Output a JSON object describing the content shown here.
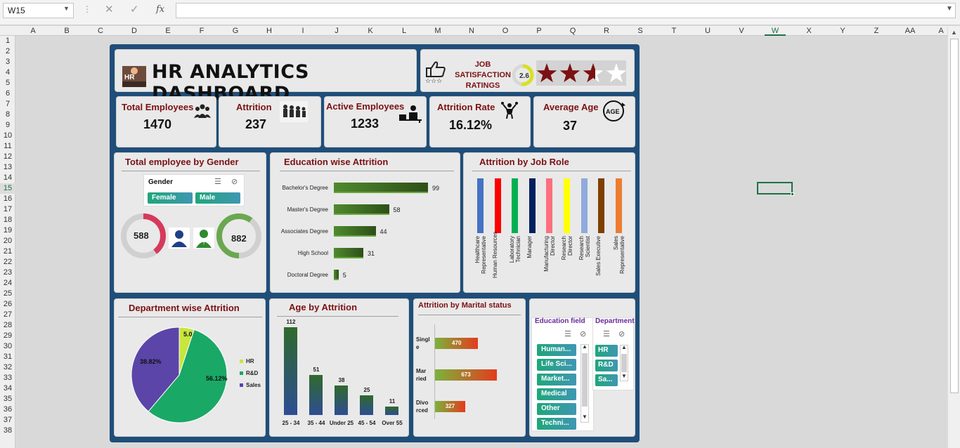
{
  "formula_bar": {
    "name_box": "W15",
    "cancel_icon": "✕",
    "enter_icon": "✓",
    "fx_label": "fx",
    "formula": ""
  },
  "columns": [
    "A",
    "B",
    "C",
    "D",
    "E",
    "F",
    "G",
    "H",
    "I",
    "J",
    "K",
    "L",
    "M",
    "N",
    "O",
    "P",
    "Q",
    "R",
    "S",
    "T",
    "U",
    "V",
    "W",
    "X",
    "Y",
    "Z",
    "AA",
    "A"
  ],
  "selected_column": "W",
  "rows": [
    "1",
    "2",
    "3",
    "4",
    "5",
    "6",
    "7",
    "8",
    "9",
    "10",
    "11",
    "12",
    "13",
    "14",
    "15",
    "16",
    "17",
    "18",
    "19",
    "20",
    "21",
    "22",
    "23",
    "24",
    "25",
    "26",
    "27",
    "28",
    "29",
    "30",
    "31",
    "32",
    "33",
    "34",
    "35",
    "36",
    "37",
    "38"
  ],
  "selected_row": "15",
  "dashboard": {
    "title": "HR ANALYTICS DASHBOARD",
    "logo_text": "HR",
    "job_satisfaction": {
      "label": "JOB SATISFACTION RATINGS",
      "value": "2.6",
      "rating": 2.6,
      "max_stars": 4,
      "star_color": "#7b1113"
    },
    "kpis": [
      {
        "title": "Total Employees",
        "value": "1470",
        "icon": "people-group-icon"
      },
      {
        "title": "Attrition",
        "value": "237",
        "icon": "people-leaving-icon"
      },
      {
        "title": "Active Employees",
        "value": "1233",
        "icon": "employee-desk-icon"
      },
      {
        "title": "Attrition Rate",
        "value": "16.12%",
        "icon": "juggling-person-icon"
      },
      {
        "title": "Average Age",
        "value": "37",
        "icon": "age-icon"
      }
    ],
    "gender": {
      "title": "Total employee by Gender",
      "slicer": {
        "header": "Gender",
        "options": [
          "Female",
          "Male"
        ]
      },
      "female_count": "588",
      "male_count": "882"
    },
    "education_attrition": {
      "title": "Education wise Attrition",
      "chart_data": {
        "type": "bar",
        "orientation": "horizontal",
        "categories": [
          "Bachelor's Degree",
          "Master's Degree",
          "Associates Degree",
          "High School",
          "Doctoral Degree"
        ],
        "values": [
          99,
          58,
          44,
          31,
          5
        ]
      }
    },
    "job_role": {
      "title": "Attrition by Job Role",
      "chart_data": {
        "type": "bar",
        "categories": [
          "Healthcare Representative",
          "Human Resources",
          "Laboratory Technician",
          "Manager",
          "Manufacturing Director",
          "Research Director",
          "Research Scientist",
          "Sales Executive",
          "Sales Representative"
        ],
        "colors": [
          "#4472c4",
          "#ff0000",
          "#00b050",
          "#002060",
          "#ff6f7d",
          "#ffff00",
          "#8faadc",
          "#7f3f00",
          "#ed7d31"
        ]
      }
    },
    "department": {
      "title": "Department wise Attrition",
      "chart_data": {
        "type": "pie",
        "categories": [
          "HR",
          "R&D",
          "Sales"
        ],
        "values": [
          5.06,
          56.12,
          38.82
        ],
        "labels": [
          "5.06%",
          "56.12%",
          "38.82%"
        ],
        "colors": [
          "#c8e63c",
          "#1aa866",
          "#5b45a8"
        ],
        "legend": "right"
      }
    },
    "age": {
      "title": "Age by Attrition",
      "chart_data": {
        "type": "bar",
        "categories": [
          "25 - 34",
          "35 - 44",
          "Under 25",
          "45 - 54",
          "Over 55"
        ],
        "values": [
          112,
          51,
          38,
          25,
          11
        ]
      }
    },
    "marital": {
      "title": "Attrition by Marital status",
      "chart_data": {
        "type": "bar",
        "orientation": "horizontal",
        "categories": [
          "Single",
          "Married",
          "Divorced"
        ],
        "values": [
          470,
          673,
          327
        ]
      }
    },
    "slicers": {
      "education_field": {
        "header": "Education field",
        "options": [
          "Human...",
          "Life Sci...",
          "Market...",
          "Medical",
          "Other",
          "Techni..."
        ]
      },
      "department": {
        "header": "Department",
        "options": [
          "HR",
          "R&D",
          "Sa..."
        ]
      }
    }
  }
}
